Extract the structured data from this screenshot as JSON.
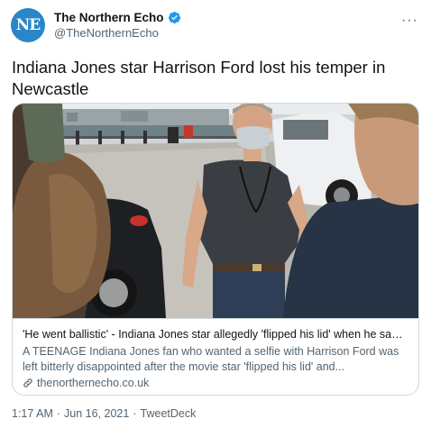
{
  "account": {
    "avatar_text": "NE",
    "display_name": "The Northern Echo",
    "handle": "@TheNorthernEcho",
    "verified_icon": "verified-badge-icon",
    "more_label": "···"
  },
  "tweet": {
    "text": "Indiana Jones star Harrison Ford lost his temper in Newcastle"
  },
  "card": {
    "title": "'He went ballistic' - Indiana Jones star allegedly 'flipped his lid' when he saw pap...",
    "description": "A TEENAGE Indiana Jones fan who wanted a selfie with Harrison Ford was left bitterly disappointed after the movie star 'flipped his lid' and...",
    "domain": "thenorthernecho.co.uk",
    "link_icon": "link-icon"
  },
  "meta": {
    "time": "1:17 AM",
    "sep1": "·",
    "date": "Jun 16, 2021",
    "sep2": "·",
    "source": "TweetDeck"
  },
  "colors": {
    "brand": "#2a86c8",
    "verified": "#1d9bf0",
    "secondary_text": "#536471",
    "border": "#cfd9de"
  }
}
